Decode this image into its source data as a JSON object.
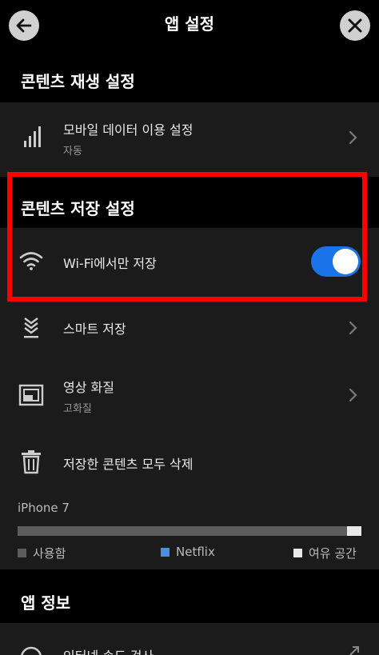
{
  "header": {
    "title": "앱 설정"
  },
  "playback": {
    "title": "콘텐츠 재생 설정",
    "mobile_data": {
      "label": "모바일 데이터 이용 설정",
      "value": "자동"
    }
  },
  "downloads": {
    "title": "콘텐츠 저장 설정",
    "wifi_only": {
      "label": "Wi-Fi에서만 저장",
      "enabled": true
    },
    "smart_downloads": {
      "label": "스마트 저장"
    },
    "video_quality": {
      "label": "영상 화질",
      "value": "고화질"
    },
    "delete_all": {
      "label": "저장한 콘텐츠 모두 삭제"
    }
  },
  "storage": {
    "device": "iPhone 7",
    "legend": [
      {
        "label": "사용함",
        "color": "#5c5c5c"
      },
      {
        "label": "Netflix",
        "color": "#4a90e2"
      },
      {
        "label": "여유 공간",
        "color": "#e8e8e8"
      }
    ]
  },
  "about": {
    "title": "앱 정보",
    "partial_row_label": "인터넷 속도 검사"
  },
  "colors": {
    "accent": "#1a73e8",
    "highlight": "#ff0000"
  }
}
